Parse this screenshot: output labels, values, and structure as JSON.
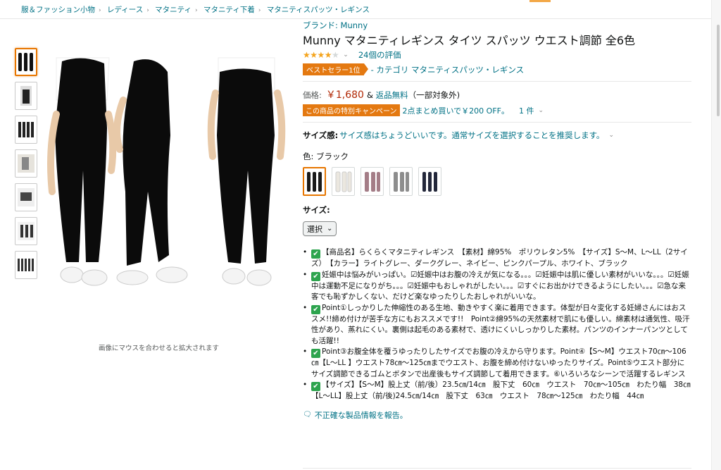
{
  "breadcrumb": [
    "服＆ファッション小物",
    "レディース",
    "マタニティ",
    "マタニティ下着",
    "マタニティスパッツ・レギンス"
  ],
  "brand": "ブランド: Munny",
  "title": "Munny マタニティレギンス タイツ スパッツ ウエスト調節 全6色",
  "rating": {
    "stars": 4.0,
    "count_text": "24個の評価"
  },
  "bestseller": {
    "badge": "ベストセラー1位",
    "category": "- カテゴリ マタニティスパッツ・レギンス"
  },
  "price": {
    "label": "価格:",
    "value": "￥1,680",
    "amp": "&",
    "shipping": "返品無料",
    "shipping_note": "（一部対象外)"
  },
  "campaign": {
    "badge": "この商品の特別キャンペーン",
    "text": "2点まとめ買いで￥200 OFF。",
    "count": "1 件"
  },
  "size_feel": {
    "label": "サイズ感:",
    "text": "サイズ感はちょうどいいです。通常サイズを選択することを推奨します。"
  },
  "color": {
    "label": "色:",
    "value": "ブラック"
  },
  "size": {
    "label": "サイズ:",
    "select_value": "選択"
  },
  "zoom_hint": "画像にマウスを合わせると拡大されます",
  "bullets": [
    "【商品名】らくらくマタニティレギンス　【素材】綿95%　ポリウレタン5%　【サイズ】S～M、L～LL（2サイズ）　【カラー】ライトグレー、ダークグレー、ネイビー、ピンクパープル、ホワイト、ブラック",
    "妊娠中は悩みがいっぱい。☑妊娠中はお腹の冷えが気になる。。。☑妊娠中は肌に優しい素材がいいな。。。☑妊娠中は運動不足になりがち。。。☑妊娠中もおしゃれがしたい。。。☑すぐにお出かけできるようにしたい。。。☑急な来客でも恥ずかしくない、だけど楽なゆったりしたおしゃれがいいな。",
    "Point①しっかりした伸縮性のある生地、動きやすく楽に着用できます。体型が日々変化する妊婦さんにはおススメ!!締め付けが苦手な方にもおススメです!!　Point②綿95%の天然素材で肌にも優しい。綿素材は通気性、吸汗性があり、蒸れにくい。裏側は起毛のある素材で、透けにくいしっかりした素材。パンツのインナーパンツとしても活躍!!",
    "Point③お腹全体を覆うゆったりしたサイズでお腹の冷えから守ります。Point④【S～M】ウエスト70㎝～106㎝【L～LL 】ウエスト78㎝～125㎝までウエスト、お腹を締め付けないゆったりサイズ。Point⑤ウエスト部分にサイズ調節できるゴムとボタンで出産後もサイズ調節して着用できます。⑥いろいろなシーンで活躍するレギンス",
    "【サイズ】【S～M】股上丈（前/後）23.5㎝/14㎝　股下丈　60㎝　ウエスト　70㎝～105㎝　わたり幅　38㎝　【L～LL】股上丈（前/後)24.5㎝/14㎝　股下丈　63㎝　ウエスト　78㎝～125㎝　わたり幅　44㎝"
  ],
  "report_text": "不正確な製品情報を報告。",
  "swatch_colors": [
    "#1a1a1a",
    "#f2efe8",
    "#b08a92",
    "#8d8d8d",
    "#23273a"
  ],
  "colors": {
    "accent": "#e47911",
    "link": "#007185",
    "price": "#b12704"
  }
}
